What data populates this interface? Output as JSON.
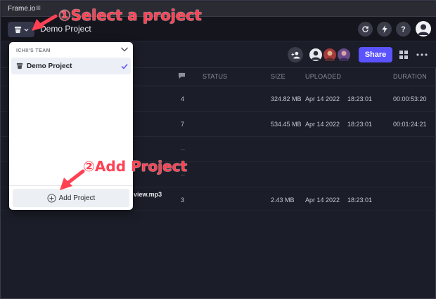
{
  "app": {
    "title": "Frame.io",
    "menu_icon": "hamburger-icon"
  },
  "topbar": {
    "project_title": "Demo Project",
    "icons": [
      "refresh-icon",
      "lightning-icon",
      "help-icon"
    ],
    "help_label": "?"
  },
  "subbar": {
    "share_label": "Share"
  },
  "table": {
    "headers": {
      "status": "STATUS",
      "size": "SIZE",
      "uploaded": "UPLOADED",
      "duration": "DURATION"
    },
    "rows": [
      {
        "name": "",
        "comments": "4",
        "size": "324.82 MB",
        "date": "Apr 14 2022",
        "time": "18:23:01",
        "duration": "00:00:53:20"
      },
      {
        "name": "",
        "comments": "7",
        "size": "534.45 MB",
        "date": "Apr 14 2022",
        "time": "18:23:01",
        "duration": "00:01:24:21"
      },
      {
        "name": "",
        "comments": "--",
        "size": "",
        "date": "",
        "time": "",
        "duration": ""
      },
      {
        "name": "",
        "comments": "--",
        "size": "",
        "date": "",
        "time": "",
        "duration": ""
      },
      {
        "name": "view.mp3",
        "comments": "3",
        "size": "2.43 MB",
        "date": "Apr 14 2022",
        "time": "18:23:01",
        "duration": ""
      }
    ]
  },
  "dropdown": {
    "team_label": "ICHII'S TEAM",
    "project_item": "Demo Project",
    "add_project_label": "Add Project"
  },
  "annotations": {
    "select_project": "①Select a project",
    "add_project": "②Add Project",
    "color": "#ff4153"
  }
}
